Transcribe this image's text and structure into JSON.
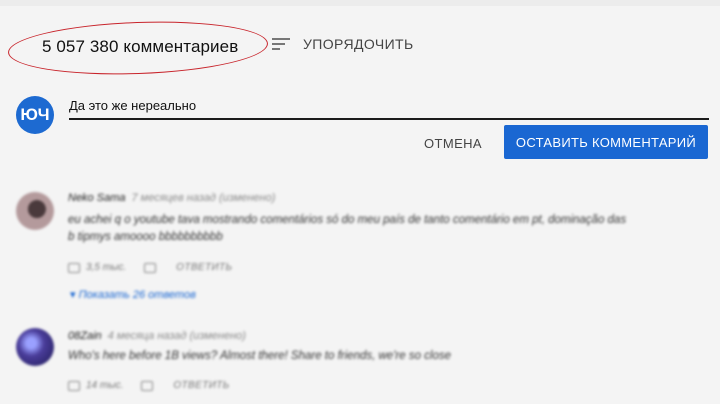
{
  "header": {
    "comment_count": "5 057 380 комментариев",
    "sort_label": "УПОРЯДОЧИТЬ"
  },
  "composer": {
    "avatar_initials": "ЮЧ",
    "input_value": "Да это же нереально",
    "cancel_label": "ОТМЕНА",
    "submit_label": "ОСТАВИТЬ КОММЕНТАРИЙ"
  },
  "comments": [
    {
      "author": "Neko Sama",
      "meta": "7 месяцев назад (изменено)",
      "text": "eu achei q o youtube tava mostrando comentários só do meu país de tanto comentário em pt, dominação das b tipmys amoooo bbbbbbbbbb",
      "likes": "3,5 тыс.",
      "reply_label": "ОТВЕТИТЬ",
      "replies_link": "▾ Показать 26 ответов",
      "avatar_color": "#9a7f82"
    },
    {
      "author": "08Zain",
      "meta": "4 месяца назад (изменено)",
      "text": "Who's here before 1B views? Almost there! Share to friends, we're so close",
      "likes": "14 тыс.",
      "reply_label": "ОТВЕТИТЬ",
      "avatar_color": "#4a3d9a"
    }
  ],
  "colors": {
    "accent": "#1a67d2",
    "annotation_circle": "#c8242b"
  }
}
